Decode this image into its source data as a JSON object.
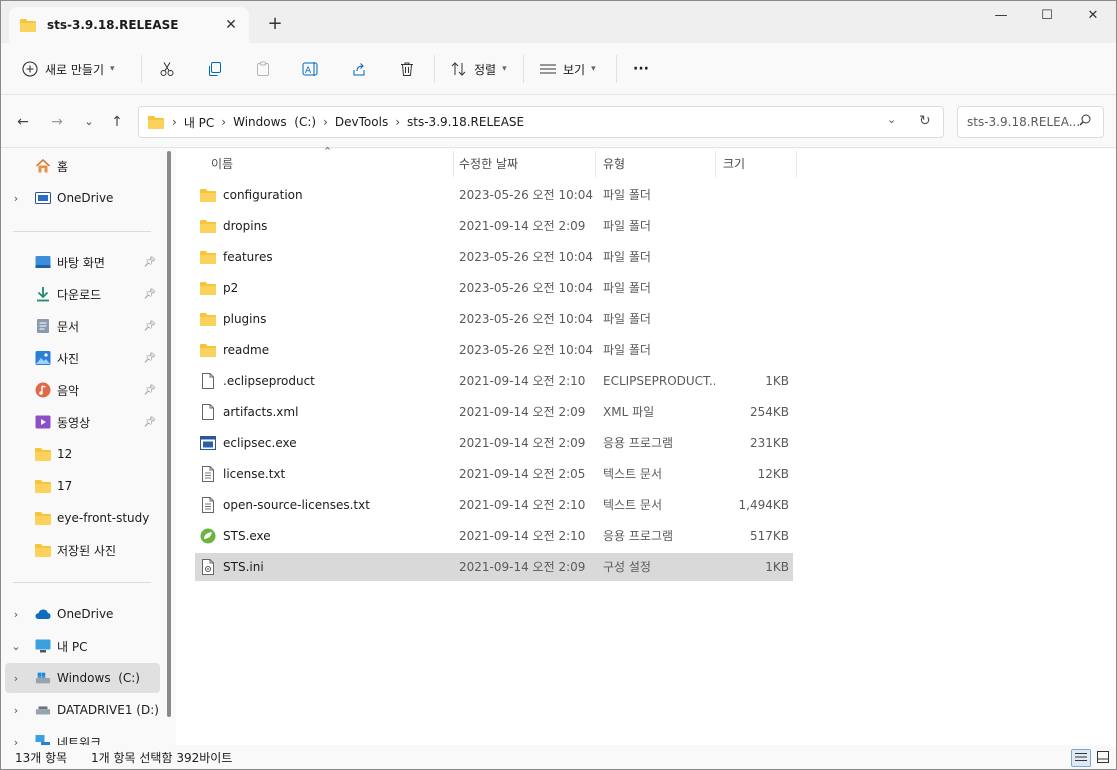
{
  "window": {
    "tab_title": "sts-3.9.18.RELEASE",
    "tab_close": "✕",
    "new_tab": "+",
    "minimize": "—",
    "maximize": "☐",
    "close": "✕"
  },
  "toolbar": {
    "new_label": "새로 만들기",
    "sort_label": "정렬",
    "view_label": "보기",
    "more_label": "···"
  },
  "address": {
    "crumbs": [
      "내 PC",
      "Windows  (C:)",
      "DevTools",
      "sts-3.9.18.RELEASE"
    ],
    "separator": "›",
    "search_placeholder": "sts-3.9.18.RELEA..."
  },
  "sidebar": {
    "home": "홈",
    "onedrive_top": "OneDrive",
    "quick": [
      {
        "label": "바탕 화면",
        "icon": "desktop-icon",
        "pinned": true
      },
      {
        "label": "다운로드",
        "icon": "download-icon",
        "pinned": true
      },
      {
        "label": "문서",
        "icon": "document-icon",
        "pinned": true
      },
      {
        "label": "사진",
        "icon": "pictures-icon",
        "pinned": true
      },
      {
        "label": "음악",
        "icon": "music-icon",
        "pinned": true
      },
      {
        "label": "동영상",
        "icon": "video-icon",
        "pinned": true
      },
      {
        "label": "12",
        "icon": "folder-icon",
        "pinned": false
      },
      {
        "label": "17",
        "icon": "folder-icon",
        "pinned": false
      },
      {
        "label": "eye-front-study",
        "icon": "folder-icon",
        "pinned": false
      },
      {
        "label": "저장된 사진",
        "icon": "folder-icon",
        "pinned": false
      }
    ],
    "onedrive": "OneDrive",
    "this_pc": "내 PC",
    "drive_c": "Windows  (C:)",
    "drive_d": "DATADRIVE1 (D:)",
    "network": "네트워크"
  },
  "columns": {
    "name": "이름",
    "date": "수정한 날짜",
    "type": "유형",
    "size": "크기"
  },
  "files": [
    {
      "name": "configuration",
      "date": "2023-05-26 오전 10:04",
      "type": "파일 폴더",
      "size": "",
      "icon": "folder-icon"
    },
    {
      "name": "dropins",
      "date": "2021-09-14 오전 2:09",
      "type": "파일 폴더",
      "size": "",
      "icon": "folder-icon"
    },
    {
      "name": "features",
      "date": "2023-05-26 오전 10:04",
      "type": "파일 폴더",
      "size": "",
      "icon": "folder-icon"
    },
    {
      "name": "p2",
      "date": "2023-05-26 오전 10:04",
      "type": "파일 폴더",
      "size": "",
      "icon": "folder-icon"
    },
    {
      "name": "plugins",
      "date": "2023-05-26 오전 10:04",
      "type": "파일 폴더",
      "size": "",
      "icon": "folder-icon"
    },
    {
      "name": "readme",
      "date": "2023-05-26 오전 10:04",
      "type": "파일 폴더",
      "size": "",
      "icon": "folder-icon"
    },
    {
      "name": ".eclipseproduct",
      "date": "2021-09-14 오전 2:10",
      "type": "ECLIPSEPRODUCT...",
      "size": "1KB",
      "icon": "file-icon"
    },
    {
      "name": "artifacts.xml",
      "date": "2021-09-14 오전 2:09",
      "type": "XML 파일",
      "size": "254KB",
      "icon": "file-icon"
    },
    {
      "name": "eclipsec.exe",
      "date": "2021-09-14 오전 2:09",
      "type": "응용 프로그램",
      "size": "231KB",
      "icon": "app-icon"
    },
    {
      "name": "license.txt",
      "date": "2021-09-14 오전 2:05",
      "type": "텍스트 문서",
      "size": "12KB",
      "icon": "text-file-icon"
    },
    {
      "name": "open-source-licenses.txt",
      "date": "2021-09-14 오전 2:10",
      "type": "텍스트 문서",
      "size": "1,494KB",
      "icon": "text-file-icon"
    },
    {
      "name": "STS.exe",
      "date": "2021-09-14 오전 2:10",
      "type": "응용 프로그램",
      "size": "517KB",
      "icon": "sts-app-icon"
    },
    {
      "name": "STS.ini",
      "date": "2021-09-14 오전 2:09",
      "type": "구성 설정",
      "size": "1KB",
      "icon": "config-file-icon",
      "selected": true
    }
  ],
  "status": {
    "count": "13개 항목",
    "selection": "1개 항목 선택함 392바이트"
  },
  "colors": {
    "folder": "#f8c53a",
    "accent": "#0067c0",
    "selected_row": "#d9d9d9"
  }
}
